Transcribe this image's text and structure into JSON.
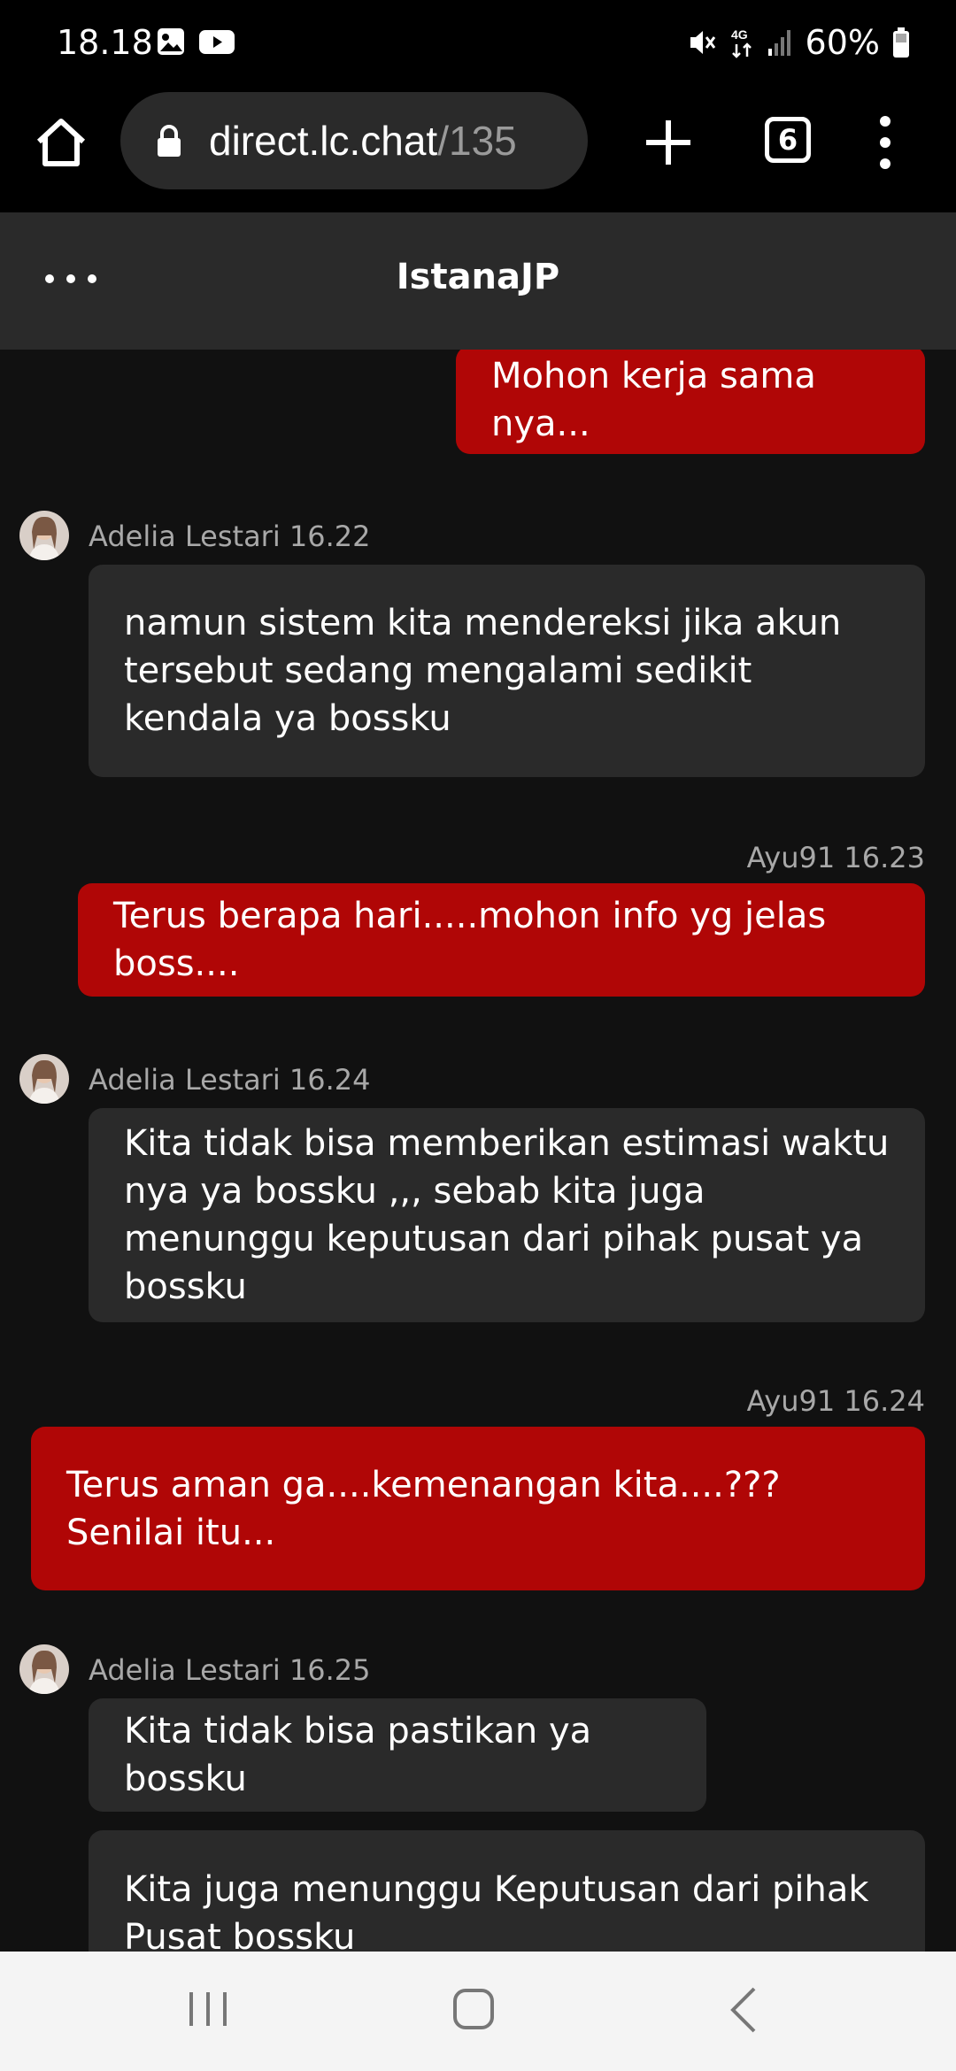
{
  "status_bar": {
    "time": "18.18",
    "battery": "60%",
    "icons": [
      "image-icon",
      "youtube-icon",
      "mute-icon",
      "4g-icon",
      "signal-icon",
      "battery-icon"
    ]
  },
  "browser": {
    "url_host": "direct.lc.chat",
    "url_path": "/135",
    "tab_count": "6",
    "icons": [
      "home-icon",
      "lock-icon",
      "plus-icon",
      "tabs-icon",
      "more-vertical-icon"
    ]
  },
  "chat_header": {
    "title": "IstanaJP",
    "menu_icon": "more-horizontal-icon"
  },
  "messages": [
    {
      "from": "me",
      "text": "Mohon kerja sama nya..."
    },
    {
      "from": "agent",
      "meta": "Adelia Lestari 16.22",
      "text": "namun sistem kita mendereksi jika akun tersebut sedang mengalami sedikit kendala ya bossku"
    },
    {
      "from": "me",
      "meta": "Ayu91 16.23",
      "text": "Terus berapa hari.....mohon info yg jelas boss...."
    },
    {
      "from": "agent",
      "meta": "Adelia Lestari 16.24",
      "text": "Kita tidak bisa memberikan estimasi waktu nya ya bossku ,,, sebab kita juga menunggu keputusan dari pihak pusat ya bossku"
    },
    {
      "from": "me",
      "meta": "Ayu91 16.24",
      "text": "Terus aman ga....kemenangan kita....??? Senilai itu..."
    },
    {
      "from": "agent",
      "meta": "Adelia Lestari 16.25",
      "text": "Kita tidak bisa pastikan ya bossku"
    },
    {
      "from": "agent",
      "text": "Kita juga menunggu Keputusan dari pihak Pusat bossku"
    }
  ],
  "nav_bar": {
    "icons": [
      "recent-apps-icon",
      "home-button-icon",
      "back-icon"
    ]
  },
  "colors": {
    "my_bubble": "#b00606",
    "agent_bubble": "#2a2a2a",
    "chat_bg": "#111111",
    "header_bg": "#2a2a2a"
  }
}
